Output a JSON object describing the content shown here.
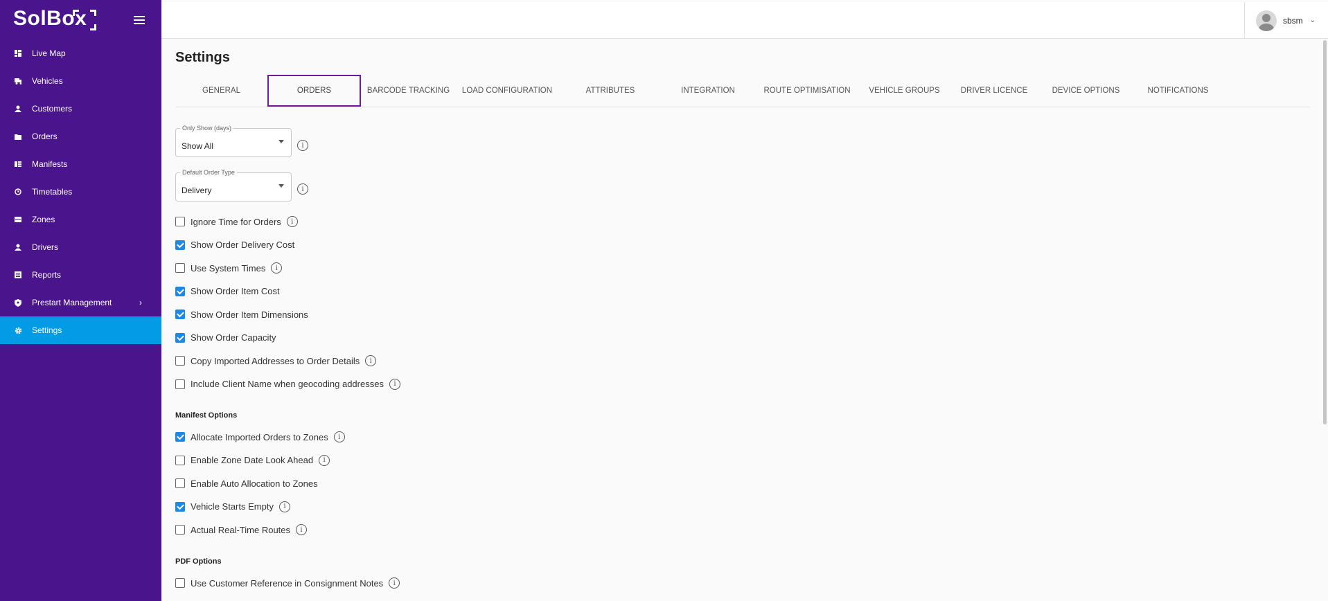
{
  "brand": {
    "name": "SolBox"
  },
  "sidebar": {
    "items": [
      {
        "label": "Live Map",
        "icon": "dashboard-icon"
      },
      {
        "label": "Vehicles",
        "icon": "truck-icon"
      },
      {
        "label": "Customers",
        "icon": "person-icon"
      },
      {
        "label": "Orders",
        "icon": "folder-icon"
      },
      {
        "label": "Manifests",
        "icon": "list-icon"
      },
      {
        "label": "Timetables",
        "icon": "clock-icon"
      },
      {
        "label": "Zones",
        "icon": "zone-icon"
      },
      {
        "label": "Drivers",
        "icon": "person-icon"
      },
      {
        "label": "Reports",
        "icon": "report-icon"
      },
      {
        "label": "Prestart Management",
        "icon": "shield-icon"
      },
      {
        "label": "Settings",
        "icon": "gear-icon",
        "active": true
      }
    ]
  },
  "topbar": {
    "username": "sbsm"
  },
  "page": {
    "title": "Settings"
  },
  "tabs": [
    {
      "label": "GENERAL"
    },
    {
      "label": "ORDERS",
      "active": true
    },
    {
      "label": "BARCODE TRACKING"
    },
    {
      "label": "LOAD CONFIGURATION"
    },
    {
      "label": "ATTRIBUTES"
    },
    {
      "label": "INTEGRATION"
    },
    {
      "label": "ROUTE OPTIMISATION"
    },
    {
      "label": "VEHICLE GROUPS"
    },
    {
      "label": "DRIVER LICENCE"
    },
    {
      "label": "DEVICE OPTIONS"
    },
    {
      "label": "NOTIFICATIONS"
    }
  ],
  "fields": {
    "only_show": {
      "label": "Only Show (days)",
      "value": "Show All"
    },
    "order_type": {
      "label": "Default Order Type",
      "value": "Delivery"
    }
  },
  "order_options": [
    {
      "label": "Ignore Time for Orders",
      "checked": false,
      "info": true
    },
    {
      "label": "Show Order Delivery Cost",
      "checked": true,
      "info": false
    },
    {
      "label": "Use System Times",
      "checked": false,
      "info": true
    },
    {
      "label": "Show Order Item Cost",
      "checked": true,
      "info": false
    },
    {
      "label": "Show Order Item Dimensions",
      "checked": true,
      "info": false
    },
    {
      "label": "Show Order Capacity",
      "checked": true,
      "info": false
    },
    {
      "label": "Copy Imported Addresses to Order Details",
      "checked": false,
      "info": true
    },
    {
      "label": "Include Client Name when geocoding addresses",
      "checked": false,
      "info": true
    }
  ],
  "manifest_section": {
    "title": "Manifest Options"
  },
  "manifest_options": [
    {
      "label": "Allocate Imported Orders to Zones",
      "checked": true,
      "info": true
    },
    {
      "label": "Enable Zone Date Look Ahead",
      "checked": false,
      "info": true
    },
    {
      "label": "Enable Auto Allocation to Zones",
      "checked": false,
      "info": false
    },
    {
      "label": "Vehicle Starts Empty",
      "checked": true,
      "info": true
    },
    {
      "label": "Actual Real-Time Routes",
      "checked": false,
      "info": true
    }
  ],
  "pdf_section": {
    "title": "PDF Options"
  },
  "pdf_options": [
    {
      "label": "Use Customer Reference in Consignment Notes",
      "checked": false,
      "info": true
    }
  ],
  "colors": {
    "sidebar_bg": "#4a148c",
    "active_nav": "#039be5",
    "active_tab_border": "#6a1b9a",
    "checkbox_checked": "#1e88e5"
  }
}
